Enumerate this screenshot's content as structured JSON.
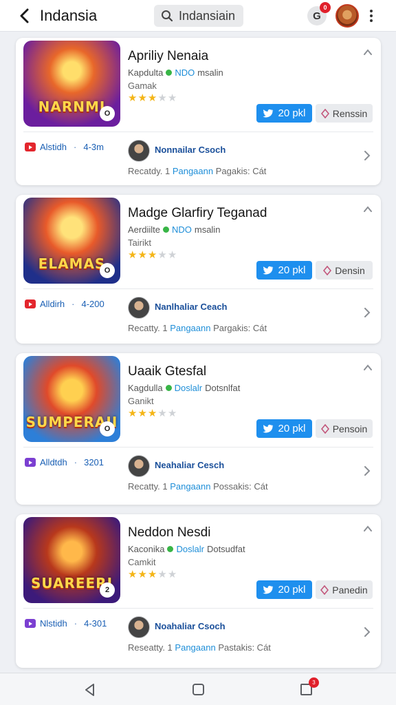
{
  "header": {
    "title": "Indansia",
    "search_text": "Indansiain",
    "notification_count": "0",
    "notification_letter": "G"
  },
  "cards": [
    {
      "title": "Apriliy Nenaia",
      "thumb_word": "NARNMI",
      "meta_prefix": "Kapdulta",
      "meta_highlight": "NDO",
      "meta_suffix": "msalin",
      "subtitle": "Gamak",
      "rating": 3,
      "primary_button": "20 pkl",
      "secondary_button": "Renssin",
      "source": "Alstidh",
      "source_time": "4-3m",
      "source_color": "#e3262d",
      "author": "Nonnailar Csoch",
      "footer_prefix": "Recatdy. 1",
      "footer_highlight": "Pangaann",
      "footer_suffix": "Pagakis: Cát",
      "thumb_play": "O"
    },
    {
      "title": "Madge Glarfiry Teganad",
      "thumb_word": "ELAMAS",
      "meta_prefix": "Aerdiilte",
      "meta_highlight": "NDO",
      "meta_suffix": "msalin",
      "subtitle": "Tairikt",
      "rating": 3,
      "primary_button": "20 pkl",
      "secondary_button": "Densin",
      "source": "Alldirh",
      "source_time": "4-200",
      "source_color": "#e3262d",
      "author": "Nanlhaliar Ceach",
      "footer_prefix": "Recatty. 1",
      "footer_highlight": "Pangaann",
      "footer_suffix": "Pargakis: Cát",
      "thumb_play": "O"
    },
    {
      "title": "Uaaik Gtesfal",
      "thumb_word": "SUMPERAII",
      "meta_prefix": "Kagdulla",
      "meta_highlight": "Doslalr",
      "meta_suffix": "Dotsnlfat",
      "subtitle": "Ganikt",
      "rating": 3,
      "primary_button": "20 pkl",
      "secondary_button": "Pensoin",
      "source": "Alldtdh",
      "source_time": "3201",
      "source_color": "#7b3fd1",
      "author": "Neahaliar Cesch",
      "footer_prefix": "Recatty. 1",
      "footer_highlight": "Pangaann",
      "footer_suffix": "Possakis: Cát",
      "thumb_play": "O"
    },
    {
      "title": "Neddon Nesdi",
      "thumb_word": "SUAREERI",
      "meta_prefix": "Kaconika",
      "meta_highlight": "Doslalr",
      "meta_suffix": "Dotsudfat",
      "subtitle": "Camkit",
      "rating": 3,
      "primary_button": "20 pkl",
      "secondary_button": "Panedin",
      "source": "Nlstidh",
      "source_time": "4-301",
      "source_color": "#7b3fd1",
      "author": "Noahaliar Csoch",
      "footer_prefix": "Reseatty. 1",
      "footer_highlight": "Pangaann",
      "footer_suffix": "Pastakis: Cát",
      "thumb_play": "2"
    }
  ],
  "navbar": {
    "recent_badge": "3"
  },
  "colors": {
    "accent": "#1e8fee",
    "link": "#1a5fb4",
    "star": "#f4b517",
    "badge": "#e0202b"
  },
  "icons": [
    "back-arrow-icon",
    "search-icon",
    "more-vertical-icon",
    "chevron-up-icon",
    "chevron-right-icon",
    "twitter-bird-icon",
    "diamond-icon",
    "video-play-icon",
    "nav-back-icon",
    "nav-home-icon",
    "nav-recent-icon"
  ]
}
